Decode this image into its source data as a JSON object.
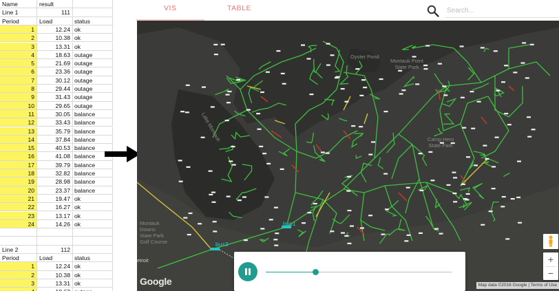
{
  "spreadsheet": {
    "header": [
      "Name",
      "result",
      ""
    ],
    "block1": {
      "name": "Line 1",
      "result": "111",
      "columns": [
        "Period",
        "Load",
        "status"
      ],
      "rows": [
        [
          "1",
          "12.24",
          "ok"
        ],
        [
          "2",
          "10.38",
          "ok"
        ],
        [
          "3",
          "13.31",
          "ok"
        ],
        [
          "4",
          "18.63",
          "outage"
        ],
        [
          "5",
          "21.69",
          "outage"
        ],
        [
          "6",
          "23.36",
          "outage"
        ],
        [
          "7",
          "30.12",
          "outage"
        ],
        [
          "8",
          "29.44",
          "outage"
        ],
        [
          "9",
          "31.43",
          "outage"
        ],
        [
          "10",
          "29.65",
          "outage"
        ],
        [
          "11",
          "30.05",
          "balance"
        ],
        [
          "12",
          "33.43",
          "balance"
        ],
        [
          "13",
          "35.79",
          "balance"
        ],
        [
          "14",
          "37.84",
          "balance"
        ],
        [
          "15",
          "40.53",
          "balance"
        ],
        [
          "16",
          "41.08",
          "balance"
        ],
        [
          "17",
          "39.79",
          "balance"
        ],
        [
          "18",
          "32.82",
          "balance"
        ],
        [
          "19",
          "28.98",
          "balance"
        ],
        [
          "20",
          "23.37",
          "balance"
        ],
        [
          "21",
          "19.47",
          "ok"
        ],
        [
          "22",
          "16.27",
          "ok"
        ],
        [
          "23",
          "13.17",
          "ok"
        ],
        [
          "24",
          "14.26",
          "ok"
        ]
      ]
    },
    "block2": {
      "name": "Line 2",
      "result": "112",
      "columns": [
        "Period",
        "Load",
        "status"
      ],
      "rows": [
        [
          "1",
          "12.24",
          "ok"
        ],
        [
          "2",
          "10.38",
          "ok"
        ],
        [
          "3",
          "13.31",
          "ok"
        ],
        [
          "4",
          "18.63",
          "outage"
        ]
      ]
    }
  },
  "tabs": [
    {
      "label": "VIS",
      "active": true
    },
    {
      "label": "TABLE",
      "active": false
    }
  ],
  "search": {
    "placeholder": "Search...",
    "value": "",
    "icon": "search-icon"
  },
  "map": {
    "labels": {
      "oyster_pond": "Oyster Pond",
      "montauk_point": "Montauk Point\nState Park",
      "camp_hero": "Camp Hero\nState Park",
      "lake_montauk": "Lake Montauk",
      "montauk_downs": "Montauk\nDowns\nState Park\nGolf Course",
      "detroit": "etroit",
      "bus1": "bus1",
      "bus3": "bus3"
    },
    "logo": "Google",
    "attribution": "Map data ©2016 Google | Terms of Use",
    "colors": {
      "normal": "#3fbf3f",
      "outage": "#c0392b",
      "warning": "#d4c23a",
      "background": "#30302e"
    }
  },
  "player": {
    "state": "playing",
    "progress": 0.27,
    "accent": "#229c8e"
  },
  "zoom": {
    "in_label": "+",
    "out_label": "−"
  }
}
